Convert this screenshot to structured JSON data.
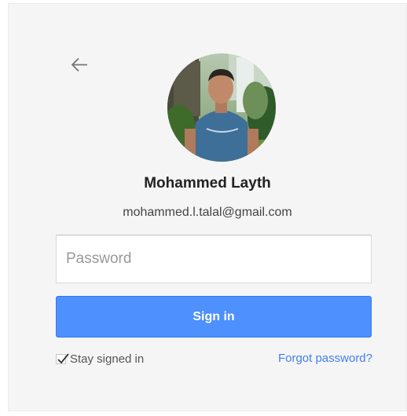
{
  "account": {
    "name": "Mohammed Layth",
    "email": "mohammed.l.talal@gmail.com"
  },
  "form": {
    "password_placeholder": "Password",
    "signin_label": "Sign in",
    "stay_signed_in_label": "Stay signed in",
    "stay_signed_in_checked": true,
    "forgot_password_label": "Forgot password?"
  },
  "icons": {
    "back": "arrow-left-icon",
    "check": "checkmark-icon"
  },
  "colors": {
    "primary_button": "#4d90fe",
    "link": "#427fed",
    "card_background": "#f5f5f5"
  }
}
